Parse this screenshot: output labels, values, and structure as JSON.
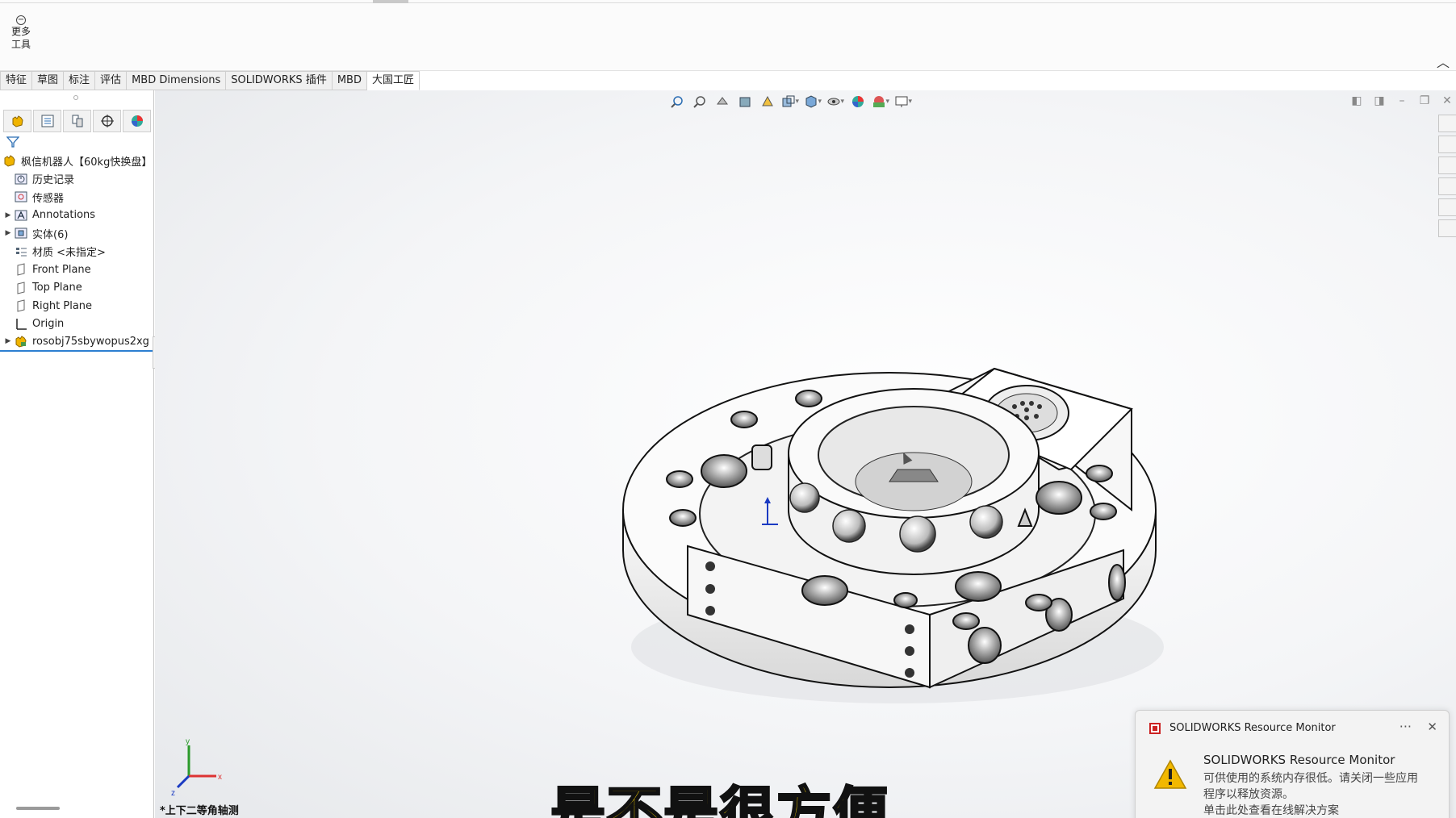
{
  "ribbon": {
    "more_tools_label": "更多\n工具",
    "more_tools_line1": "更多",
    "more_tools_line2": "工具"
  },
  "tabs": [
    {
      "label": "特征"
    },
    {
      "label": "草图"
    },
    {
      "label": "标注"
    },
    {
      "label": "评估"
    },
    {
      "label": "MBD Dimensions"
    },
    {
      "label": "SOLIDWORKS 插件"
    },
    {
      "label": "MBD"
    },
    {
      "label": "大国工匠",
      "active": true
    }
  ],
  "tree": {
    "root": "枫信机器人【60kg快换盘】",
    "items": [
      {
        "label": "历史记录",
        "icon": "history-icon",
        "expandable": false
      },
      {
        "label": "传感器",
        "icon": "sensor-icon",
        "expandable": false
      },
      {
        "label": "Annotations",
        "icon": "annotations-icon",
        "expandable": true
      },
      {
        "label": "实体(6)",
        "icon": "solid-bodies-icon",
        "expandable": true
      },
      {
        "label": "材质 <未指定>",
        "icon": "material-icon",
        "expandable": false
      },
      {
        "label": "Front Plane",
        "icon": "plane-icon",
        "expandable": false
      },
      {
        "label": "Top Plane",
        "icon": "plane-icon",
        "expandable": false
      },
      {
        "label": "Right Plane",
        "icon": "plane-icon",
        "expandable": false
      },
      {
        "label": "Origin",
        "icon": "origin-icon",
        "expandable": false
      },
      {
        "label": "rosobj75sbywopus2xg",
        "icon": "part-icon",
        "expandable": true,
        "selected": true
      }
    ]
  },
  "viewport": {
    "view_name": "*上下二等角轴测",
    "triad_axes": [
      "x",
      "y",
      "z"
    ]
  },
  "subtitle": "是不是很方便",
  "notification": {
    "app": "SOLIDWORKS Resource Monitor",
    "title": "SOLIDWORKS Resource Monitor",
    "body_line1": "可供使用的系统内存很低。请关闭一些应用",
    "body_line2": "程序以释放资源。",
    "body_line3": "单击此处查看在线解决方案",
    "more": "···",
    "close": "✕"
  },
  "colors": {
    "accent": "#2c7fd1",
    "subtitle_fill": "#ffd700",
    "warning": "#f2b800"
  }
}
